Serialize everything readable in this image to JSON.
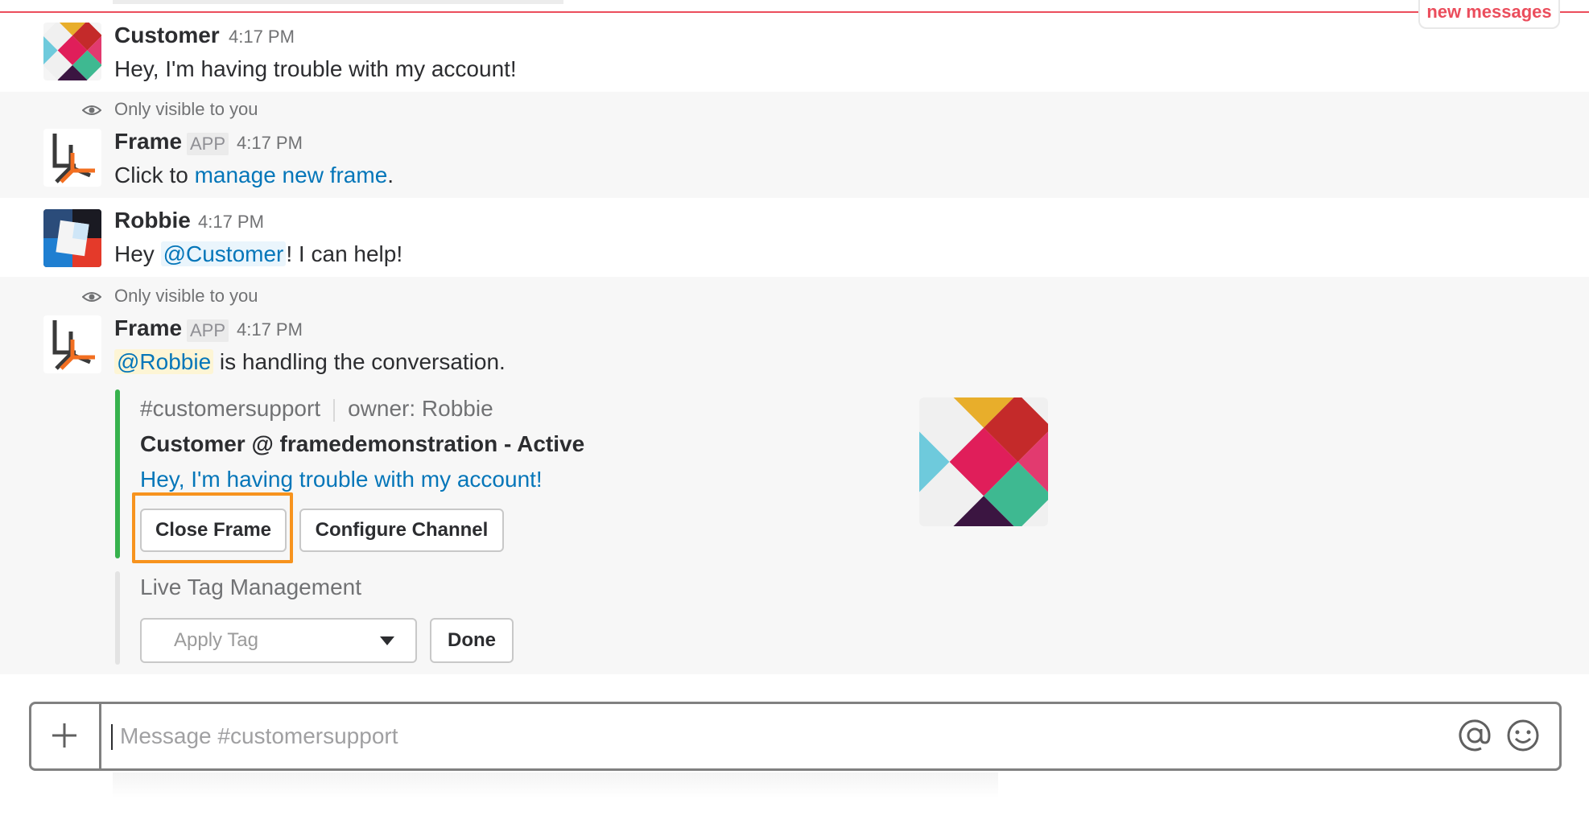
{
  "header": {
    "new_messages_label": "new messages"
  },
  "messages": [
    {
      "author": "Customer",
      "time": "4:17 PM",
      "text": "Hey, I'm having trouble with my account!"
    },
    {
      "visibility_note": "Only visible to you",
      "author": "Frame",
      "app_tag": "APP",
      "time": "4:17 PM",
      "text_prefix": "Click to ",
      "link_text": "manage new frame",
      "text_suffix": "."
    },
    {
      "author": "Robbie",
      "time": "4:17 PM",
      "text_prefix": "Hey ",
      "mention": "@Customer",
      "text_suffix": "! I can help!"
    },
    {
      "visibility_note": "Only visible to you",
      "author": "Frame",
      "app_tag": "APP",
      "time": "4:17 PM",
      "mention": "@Robbie",
      "text_suffix": " is handling the conversation."
    }
  ],
  "attachment": {
    "channel": "#customersupport",
    "owner": "owner: Robbie",
    "title": "Customer @ framedemonstration - Active",
    "message_link": "Hey, I'm having trouble with my account!",
    "buttons": {
      "close_frame": "Close Frame",
      "configure_channel": "Configure Channel"
    },
    "accent_color": "#37b24d",
    "highlight_color": "#f7931e"
  },
  "tag_management": {
    "title": "Live Tag Management",
    "select_placeholder": "Apply Tag",
    "done_label": "Done"
  },
  "composer": {
    "placeholder": "Message #customersupport",
    "icons": [
      "plus-icon",
      "at-icon",
      "emoji-icon"
    ]
  },
  "colors": {
    "link": "#0576b9",
    "new_messages": "#eb4d5c"
  }
}
